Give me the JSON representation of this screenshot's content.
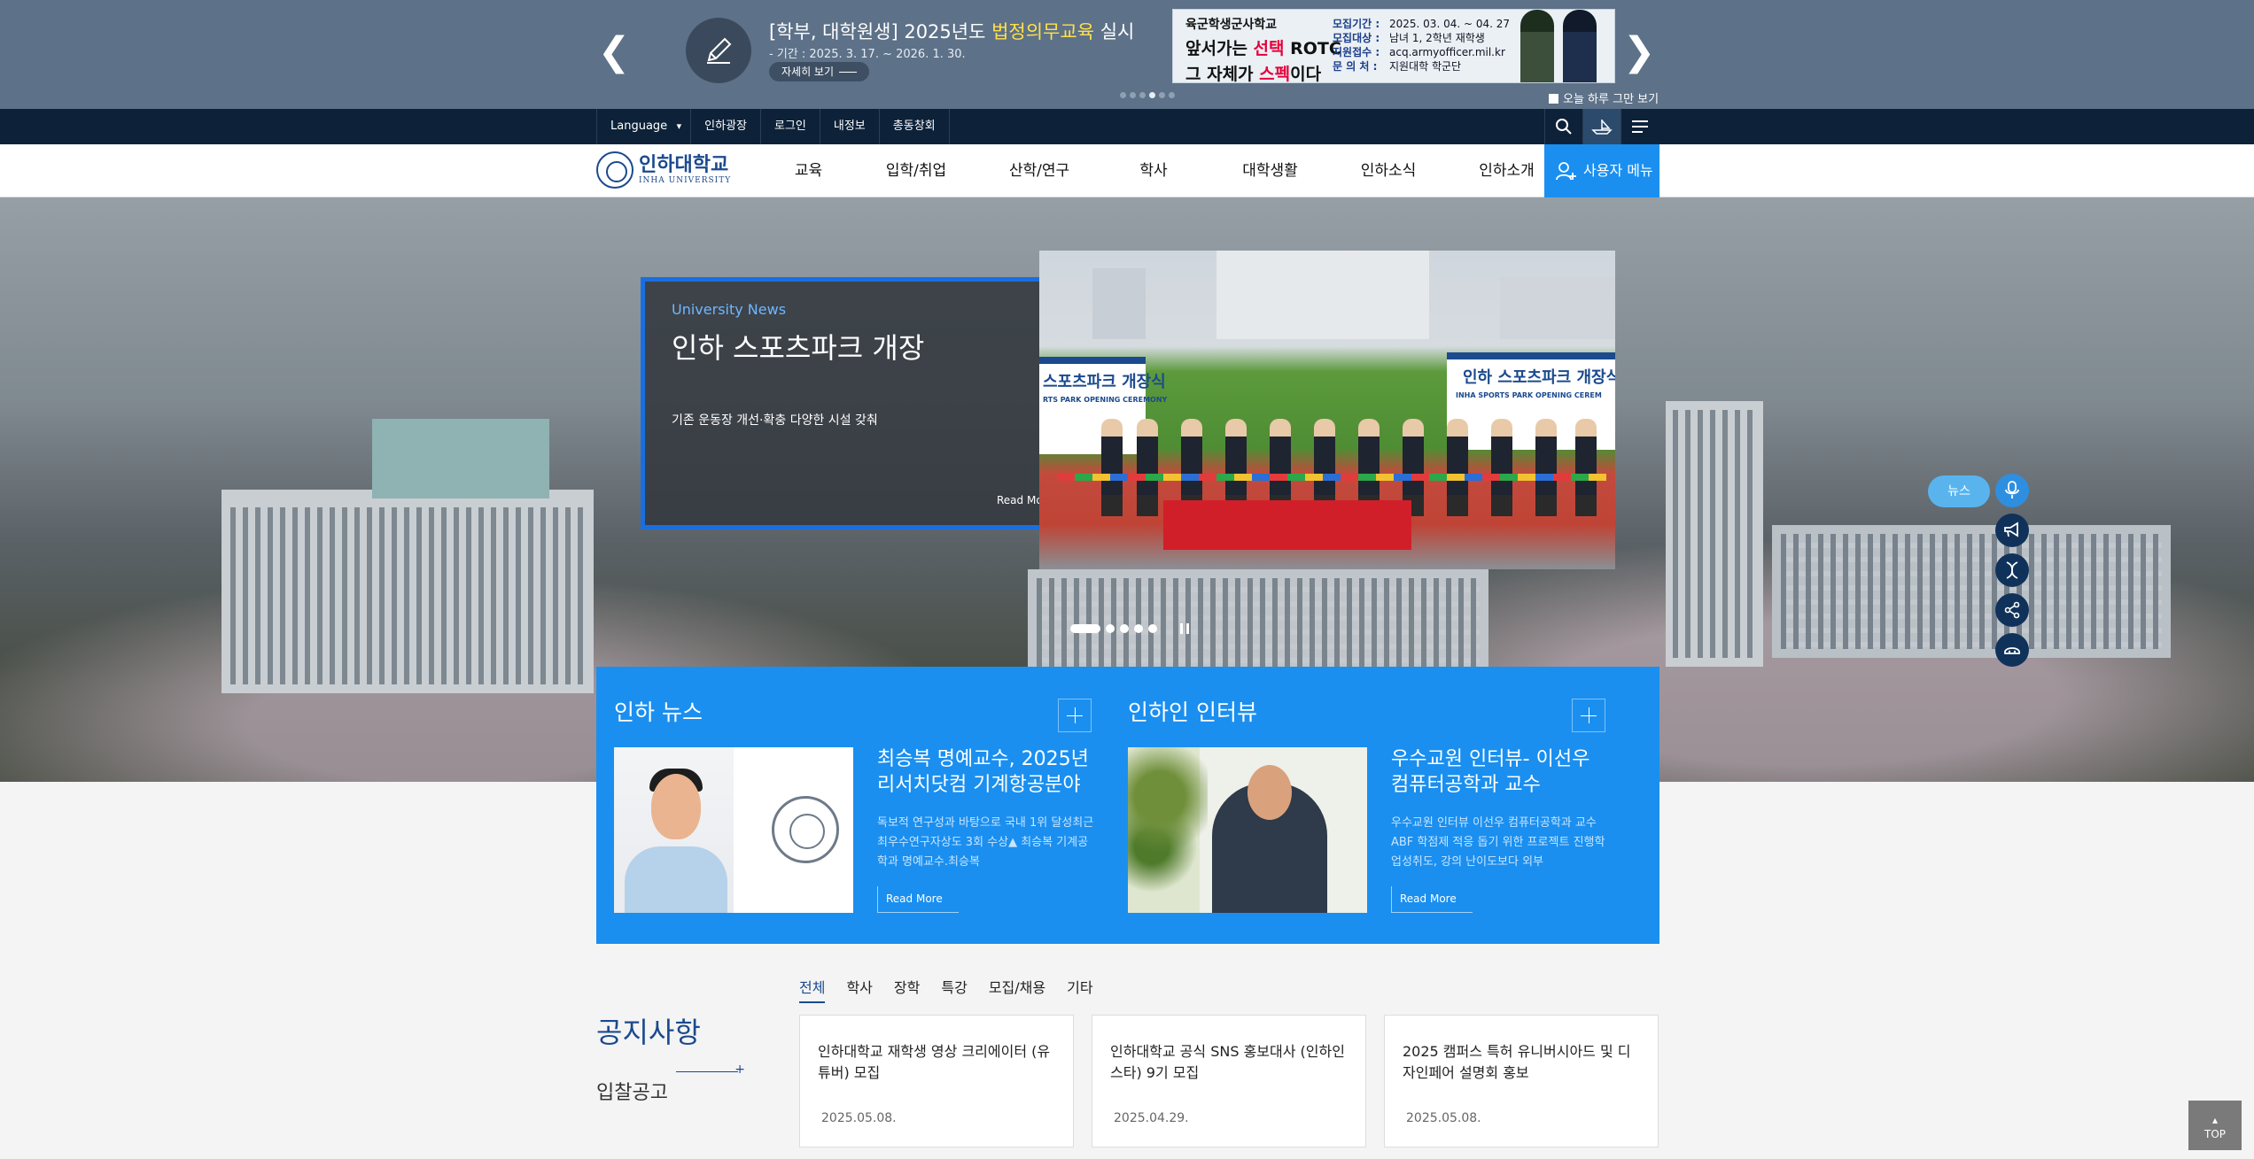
{
  "banner": {
    "title_prefix": "[학부, 대학원생] 2025년도 ",
    "title_highlight": "법정의무교육",
    "title_suffix": " 실시",
    "period": "- 기간 : 2025. 3. 17. ~ 2026. 1. 30.",
    "more_label": "자세히 보기",
    "ad": {
      "line1": "육군학생군사학교",
      "line2a": "앞서가는 ",
      "line2b": "선택",
      "line2c": " ROTC",
      "line3a": "그 자체가 ",
      "line3b": "스펙",
      "line3c": "이다",
      "info": [
        {
          "k": "모집기간 :",
          "v": "2025. 03. 04. ~ 04. 27"
        },
        {
          "k": "모집대상 :",
          "v": "남녀 1, 2학년 재학생"
        },
        {
          "k": "지원접수 :",
          "v": "acq.armyofficer.mil.kr"
        },
        {
          "k": "문 의 처 :",
          "v": "지원대학 학군단"
        }
      ]
    },
    "today_label": "오늘 하루 그만 보기",
    "slide_count": 6,
    "active_slide": 4
  },
  "utility": {
    "links": [
      "Language",
      "인하광장",
      "로그인",
      "내정보",
      "총동창회"
    ]
  },
  "nav": {
    "logo_ko": "인하대학교",
    "logo_en": "INHA UNIVERSITY",
    "menu": [
      "교육",
      "입학/취업",
      "산학/연구",
      "학사",
      "대학생활",
      "인하소식",
      "인하소개"
    ],
    "user_menu": "사용자 메뉴"
  },
  "hero": {
    "category": "University News",
    "title": "인하 스포츠파크 개장",
    "subtitle": "기존 운동장 개선·확충 다양한 시설 갖춰",
    "read_more": "Read More",
    "photo_banner_left": "스포츠파크 개장식",
    "photo_banner_right": "인하 스포츠파크 개장식",
    "photo_banner_right_en": "INHA SPORTS PARK OPENING CEREM",
    "photo_banner_left_en": "RTS PARK OPENING CEREMONY"
  },
  "quick": {
    "news_label": "뉴스",
    "icons": [
      "microphone-icon",
      "megaphone-icon",
      "dna-icon",
      "share-icon",
      "chat-icon"
    ]
  },
  "news": {
    "panel1": {
      "title": "인하 뉴스",
      "headline": "최승복 명예교수, 2025년 리서치닷컴 기계항공분야",
      "desc": "독보적 연구성과 바탕으로 국내 1위 달성최근 최우수연구자상도 3회 수상▲ 최승복 기계공학과 명예교수.최승복",
      "read_more": "Read More"
    },
    "panel2": {
      "title": "인하인 인터뷰",
      "headline": "우수교원 인터뷰- 이선우 컴퓨터공학과 교수",
      "desc": "우수교원 인터뷰 이선우 컴퓨터공학과 교수 ABF 학점제 적응 돕기 위한 프로젝트 진행학업성취도, 강의 난이도보다 외부",
      "read_more": "Read More"
    }
  },
  "notice": {
    "title": "공지사항",
    "bid": "입찰공고",
    "tabs": [
      "전체",
      "학사",
      "장학",
      "특강",
      "모집/채용",
      "기타"
    ],
    "active_tab": 0,
    "items": [
      {
        "title": "인하대학교 재학생 영상 크리에이터 (유튜버) 모집",
        "date": "2025.05.08."
      },
      {
        "title": "인하대학교 공식 SNS 홍보대사 (인하인스타) 9기 모집",
        "date": "2025.04.29."
      },
      {
        "title": "2025 캠퍼스 특허 유니버시아드 및 디자인페어 설명회 홍보",
        "date": "2025.05.08."
      }
    ]
  },
  "top_label": "TOP",
  "colors": {
    "brand_blue": "#1b4a8e",
    "accent_blue": "#1a8ff0",
    "utility_bg": "#0d2239",
    "banner_bg": "#5d7188"
  }
}
